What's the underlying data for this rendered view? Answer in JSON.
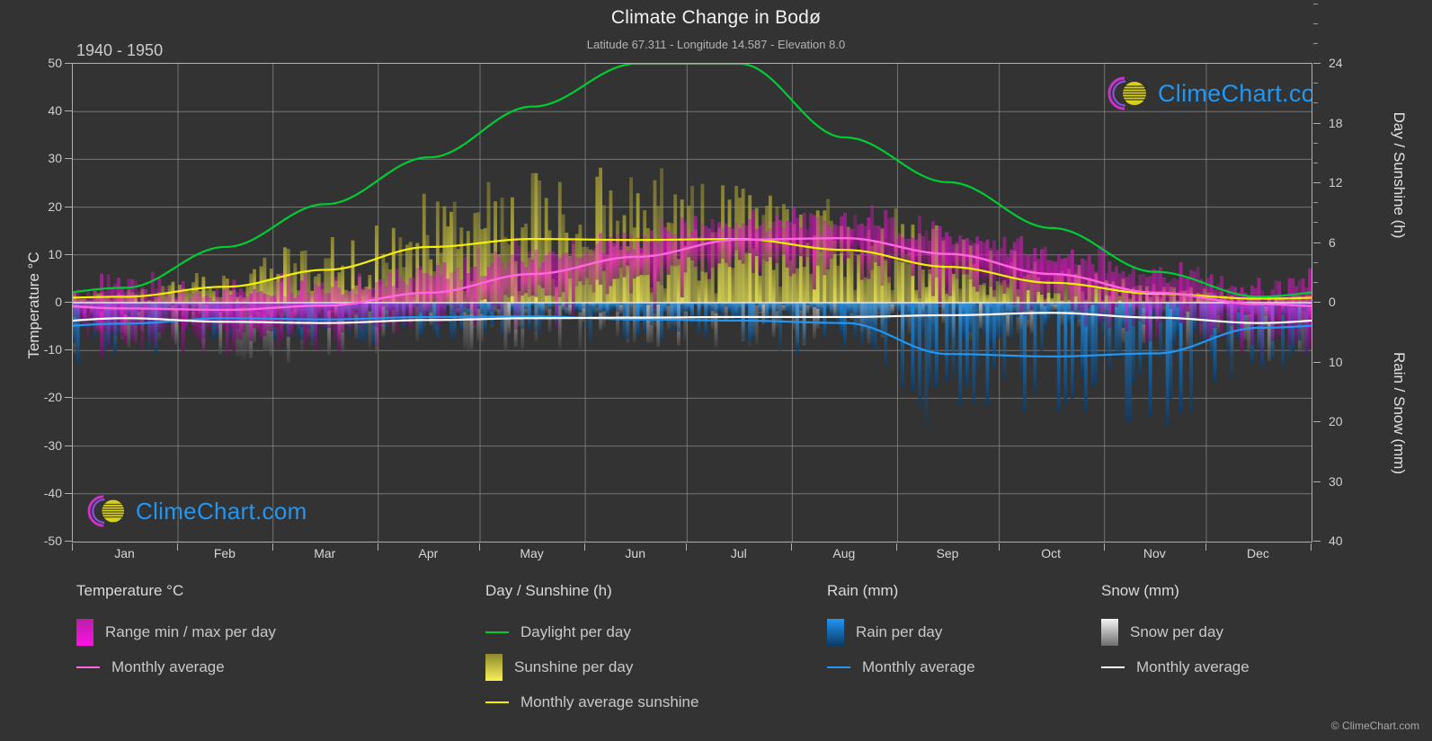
{
  "header": {
    "title": "Climate Change in Bodø",
    "subtitle": "Latitude 67.311 - Longitude 14.587 - Elevation 8.0",
    "period": "1940 - 1950"
  },
  "watermark": {
    "text": "ClimeChart.com"
  },
  "copyright": "© ClimeChart.com",
  "axes": {
    "left_label": "Temperature °C",
    "right_top_label": "Day / Sunshine (h)",
    "right_bottom_label": "Rain / Snow (mm)"
  },
  "legend": {
    "columns": [
      {
        "title": "Temperature °C",
        "items": [
          {
            "label": "Range min / max per day",
            "marker": "gradient-box",
            "color": "#ff00dd"
          },
          {
            "label": "Monthly average",
            "marker": "line",
            "color": "#ff66e0"
          }
        ]
      },
      {
        "title": "Day / Sunshine (h)",
        "items": [
          {
            "label": "Daylight per day",
            "marker": "line",
            "color": "#00cc33"
          },
          {
            "label": "Sunshine per day",
            "marker": "gradient-box",
            "color": "#f2ea4c"
          },
          {
            "label": "Monthly average sunshine",
            "marker": "line",
            "color": "#f5f000"
          }
        ]
      },
      {
        "title": "Rain (mm)",
        "items": [
          {
            "label": "Rain per day",
            "marker": "gradient-box",
            "color": "#1e90ff"
          },
          {
            "label": "Monthly average",
            "marker": "line",
            "color": "#2196f3"
          }
        ]
      },
      {
        "title": "Snow (mm)",
        "items": [
          {
            "label": "Snow per day",
            "marker": "gradient-box",
            "color": "#e8e8e8"
          },
          {
            "label": "Monthly average",
            "marker": "line",
            "color": "#ffffff"
          }
        ]
      }
    ]
  },
  "chart_data": {
    "type": "line",
    "title": "Climate Change in Bodø",
    "subtitle": "Latitude 67.311 - Longitude 14.587 - Elevation 8.0",
    "period": "1940 - 1950",
    "xlabel": "",
    "categories": [
      "Jan",
      "Feb",
      "Mar",
      "Apr",
      "May",
      "Jun",
      "Jul",
      "Aug",
      "Sep",
      "Oct",
      "Nov",
      "Dec"
    ],
    "grid": true,
    "legend_position": "below",
    "axis_temperature": {
      "label": "Temperature °C",
      "ticks": [
        50,
        40,
        30,
        20,
        10,
        0,
        -10,
        -20,
        -30,
        -40,
        -50
      ],
      "range": [
        -50,
        50
      ]
    },
    "axis_day_sunshine": {
      "label": "Day / Sunshine (h)",
      "ticks": [
        24,
        18,
        12,
        6,
        0
      ],
      "range": [
        0,
        24
      ],
      "note": "maps 0h at temperature 0 °C to 24h at temperature 50 °C"
    },
    "axis_rain_snow": {
      "label": "Rain / Snow (mm)",
      "ticks": [
        0,
        10,
        20,
        30,
        40
      ],
      "range": [
        0,
        40
      ],
      "note": "maps 0mm at temperature 0 °C to 40mm at temperature -50 °C"
    },
    "series": [
      {
        "name": "Daylight per day",
        "unit": "h",
        "color": "#00cc33",
        "axis": "day_sunshine",
        "values": [
          1.5,
          5.6,
          9.9,
          14.6,
          19.7,
          24.0,
          24.0,
          16.6,
          12.1,
          7.5,
          3.1,
          0.6
        ]
      },
      {
        "name": "Monthly average sunshine",
        "unit": "h",
        "color": "#f5f000",
        "axis": "day_sunshine",
        "values": [
          0.6,
          1.6,
          3.3,
          5.6,
          6.4,
          6.3,
          6.4,
          5.3,
          3.6,
          2.0,
          0.9,
          0.4
        ]
      },
      {
        "name": "Monthly average temperature",
        "unit": "°C",
        "color": "#ff66e0",
        "axis": "temperature",
        "values": [
          -1.2,
          -1.5,
          -0.6,
          2.1,
          6.0,
          9.6,
          13.2,
          13.5,
          10.2,
          6.0,
          2.1,
          -0.3
        ]
      },
      {
        "name": "Rain monthly average",
        "unit": "mm",
        "color": "#2196f3",
        "axis": "rain_snow",
        "values": [
          3.5,
          2.6,
          2.8,
          2.4,
          2.3,
          2.8,
          3.0,
          3.4,
          8.6,
          9.0,
          8.5,
          4.2
        ]
      },
      {
        "name": "Snow monthly average",
        "unit": "mm",
        "color": "#ffffff",
        "axis": "rain_snow",
        "values": [
          2.6,
          3.2,
          3.4,
          2.9,
          2.6,
          2.5,
          2.4,
          2.4,
          2.1,
          1.7,
          2.5,
          3.4
        ]
      }
    ],
    "daily_bands": [
      {
        "name": "Range min / max per day",
        "color": "#ff00dd",
        "axis": "temperature",
        "note": "vertical magenta bars spanning daily min to daily max temperature"
      },
      {
        "name": "Sunshine per day",
        "color": "#f2ea4c",
        "axis": "day_sunshine",
        "note": "vertical yellow bars from 0 h up to the daily sunshine hours"
      },
      {
        "name": "Rain per day",
        "color": "#1e90ff",
        "axis": "rain_snow",
        "note": "vertical blue bars hanging below 0 mm"
      },
      {
        "name": "Snow per day",
        "color": "#e8e8e8",
        "axis": "rain_snow",
        "note": "vertical grey/white bars hanging below 0 mm"
      }
    ]
  }
}
